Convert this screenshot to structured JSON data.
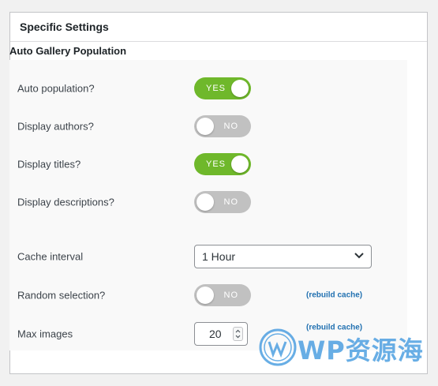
{
  "panel": {
    "title": "Specific Settings"
  },
  "section": {
    "title": "Auto Gallery Population"
  },
  "settings": [
    {
      "label": "Auto population?",
      "state": "YES"
    },
    {
      "label": "Display authors?",
      "state": "NO"
    },
    {
      "label": "Display titles?",
      "state": "YES"
    },
    {
      "label": "Display descriptions?",
      "state": "NO"
    }
  ],
  "cache_interval": {
    "label": "Cache interval",
    "value": "1 Hour"
  },
  "random_selection": {
    "label": "Random selection?",
    "state": "NO",
    "link": "(rebuild cache)"
  },
  "max_images": {
    "label": "Max images",
    "value": "20",
    "link": "(rebuild cache)"
  },
  "watermark": {
    "text": "WP资源海"
  },
  "colors": {
    "toggle_on": "#6fb82b",
    "toggle_off": "#c1c1c1",
    "link": "#2271b1",
    "watermark": "#2f8fdc"
  },
  "icons": {
    "select_arrow": "chevron-down-icon",
    "spinner": "spinner-arrows-icon",
    "logo": "wordpress-logo-icon"
  }
}
